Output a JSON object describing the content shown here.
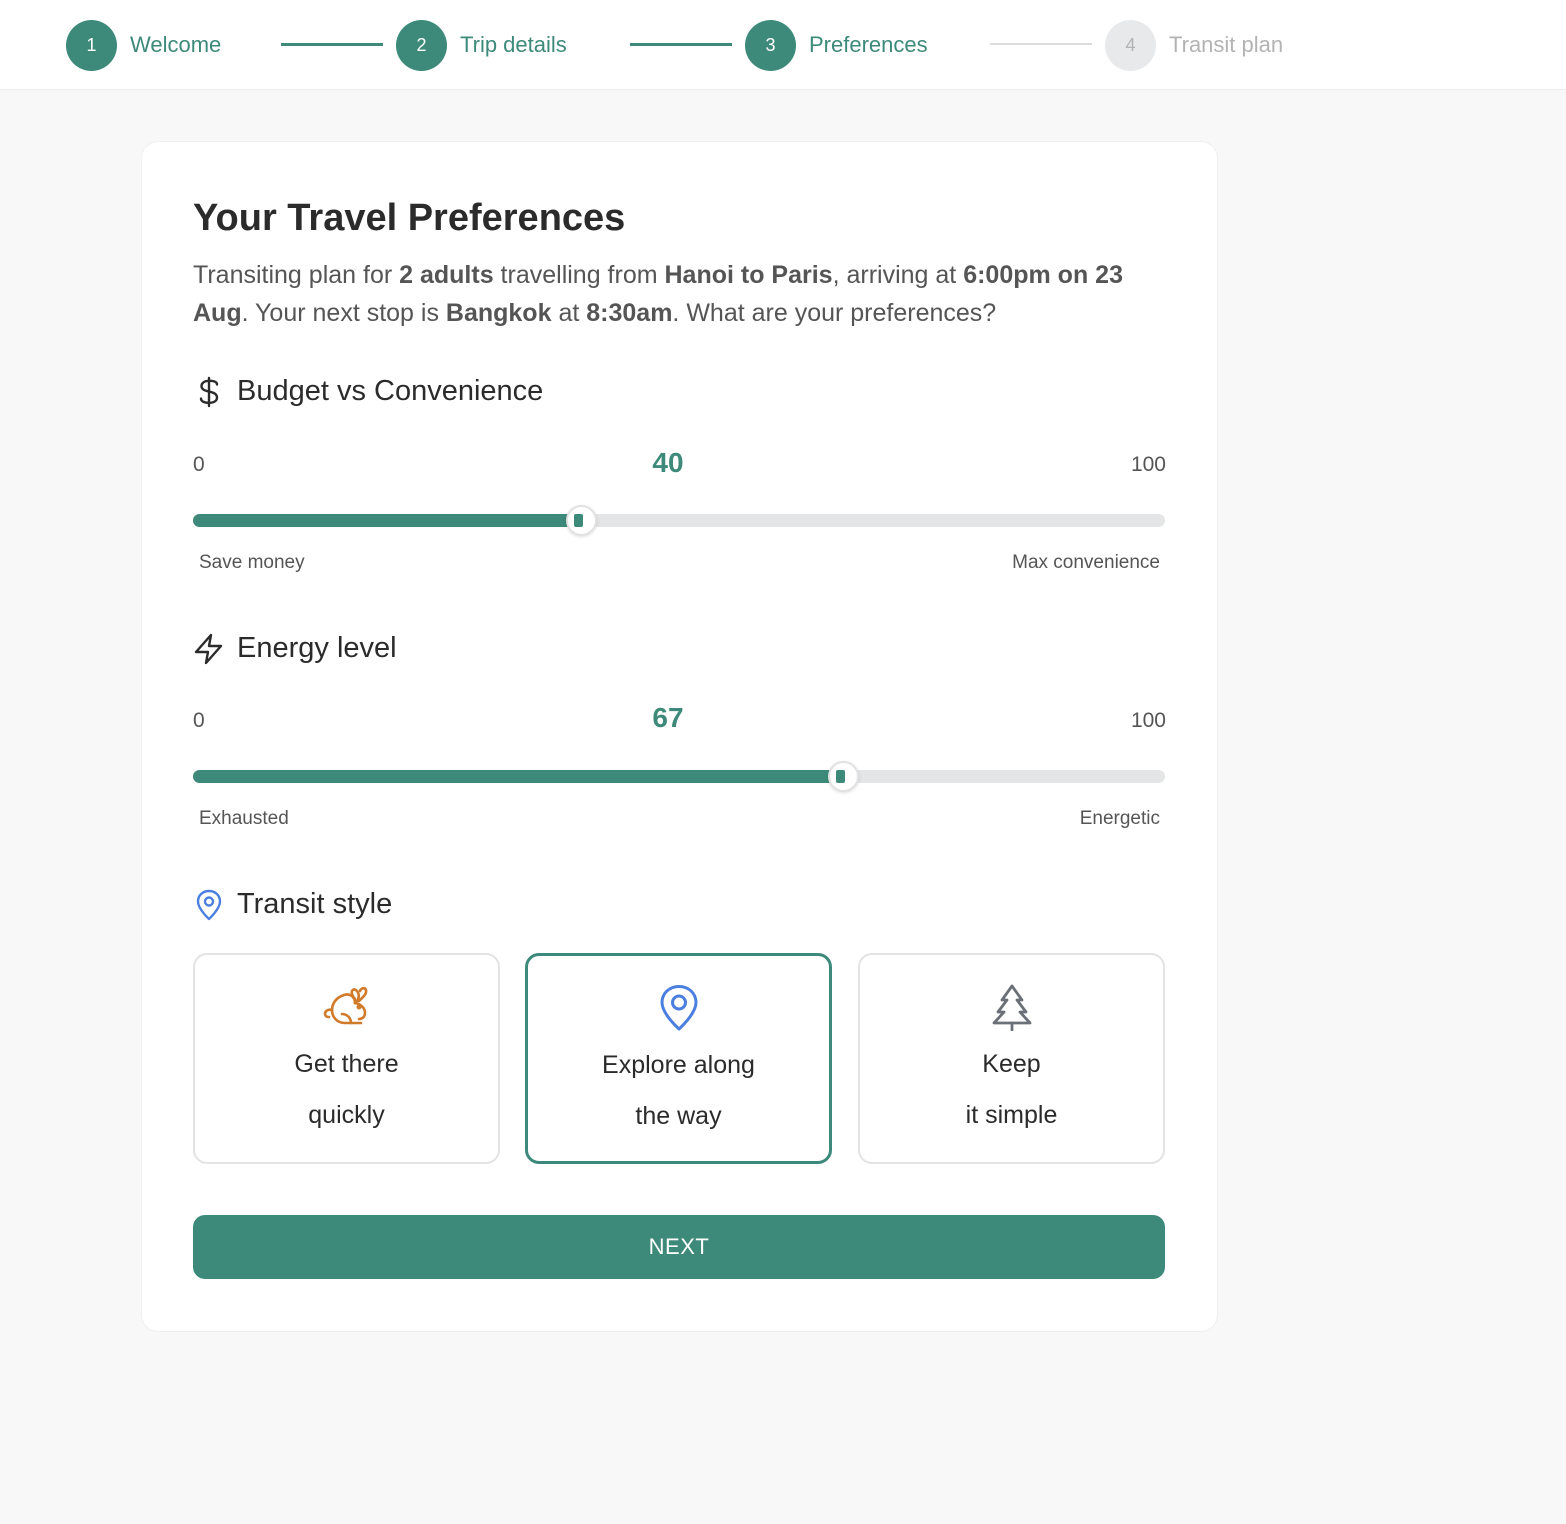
{
  "stepper": {
    "steps": [
      {
        "number": "1",
        "label": "Welcome",
        "state": "done"
      },
      {
        "number": "2",
        "label": "Trip details",
        "state": "done"
      },
      {
        "number": "3",
        "label": "Preferences",
        "state": "current"
      },
      {
        "number": "4",
        "label": "Transit plan",
        "state": "todo"
      }
    ]
  },
  "card": {
    "title": "Your Travel Preferences",
    "intro": {
      "t1": "Transiting plan for ",
      "adults": "2 adults",
      "t2": " travelling from ",
      "route": "Hanoi to Paris",
      "t3": ", arriving at ",
      "arrival": "6:00pm on 23 Aug",
      "t4": ". Your next stop is ",
      "next_stop": "Bangkok",
      "t5": " at ",
      "next_time": "8:30am",
      "t6": ". What are your preferences?"
    },
    "budget": {
      "label": "Budget vs Convenience",
      "icon": "dollar-icon",
      "min": "0",
      "max": "100",
      "value": "40",
      "value_fraction": 0.4,
      "left_caption": "Save money",
      "right_caption": "Max convenience"
    },
    "energy": {
      "label": "Energy level",
      "icon": "lightning-icon",
      "min": "0",
      "max": "100",
      "value": "67",
      "value_fraction": 0.67,
      "left_caption": "Exhausted",
      "right_caption": "Energetic"
    },
    "transit_style": {
      "label": "Transit style",
      "icon": "map-pin-icon",
      "options": [
        {
          "line1": "Get there",
          "line2": "quickly",
          "icon": "rabbit-icon",
          "icon_color": "#d07a2a",
          "selected": false
        },
        {
          "line1": "Explore along",
          "line2": "the way",
          "icon": "map-pin-icon",
          "icon_color": "#4a7fe0",
          "selected": true
        },
        {
          "line1": "Keep",
          "line2": "it simple",
          "icon": "tree-icon",
          "icon_color": "#6b6f78",
          "selected": false
        }
      ]
    },
    "next_label": "NEXT"
  },
  "colors": {
    "accent": "#3d8a7a",
    "inactive": "#b3b3b3",
    "track": "#e4e5e6",
    "pin_blue": "#4a7fe0",
    "rabbit_orange": "#d07a2a"
  }
}
